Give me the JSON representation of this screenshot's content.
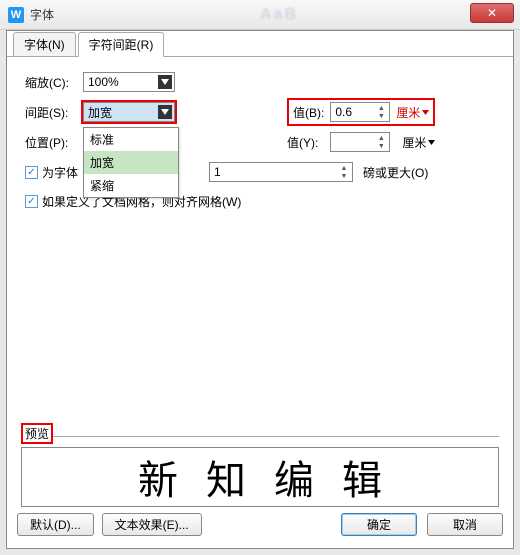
{
  "window": {
    "title": "字体",
    "close_icon": "✕"
  },
  "tabs": {
    "font": "字体(N)",
    "spacing": "字符间距(R)"
  },
  "scale": {
    "label": "缩放(C):",
    "value": "100%"
  },
  "spacing": {
    "label": "间距(S):",
    "value": "加宽",
    "options": [
      "标准",
      "加宽",
      "紧缩"
    ],
    "by_label": "值(B):",
    "by_value": "0.6",
    "unit": "厘米"
  },
  "position": {
    "label": "位置(P):",
    "value": "",
    "by_label": "值(Y):",
    "by_value": "",
    "unit": "厘米"
  },
  "kerning": {
    "checked": true,
    "label": "为字体",
    "value": "1",
    "trailing": "磅或更大(O)"
  },
  "snap": {
    "checked": true,
    "label": "如果定义了文档网格，则对齐网格(W)"
  },
  "preview": {
    "legend": "预览",
    "text": "新知编辑"
  },
  "buttons": {
    "default": "默认(D)...",
    "text_effects": "文本效果(E)...",
    "ok": "确定",
    "cancel": "取消"
  }
}
